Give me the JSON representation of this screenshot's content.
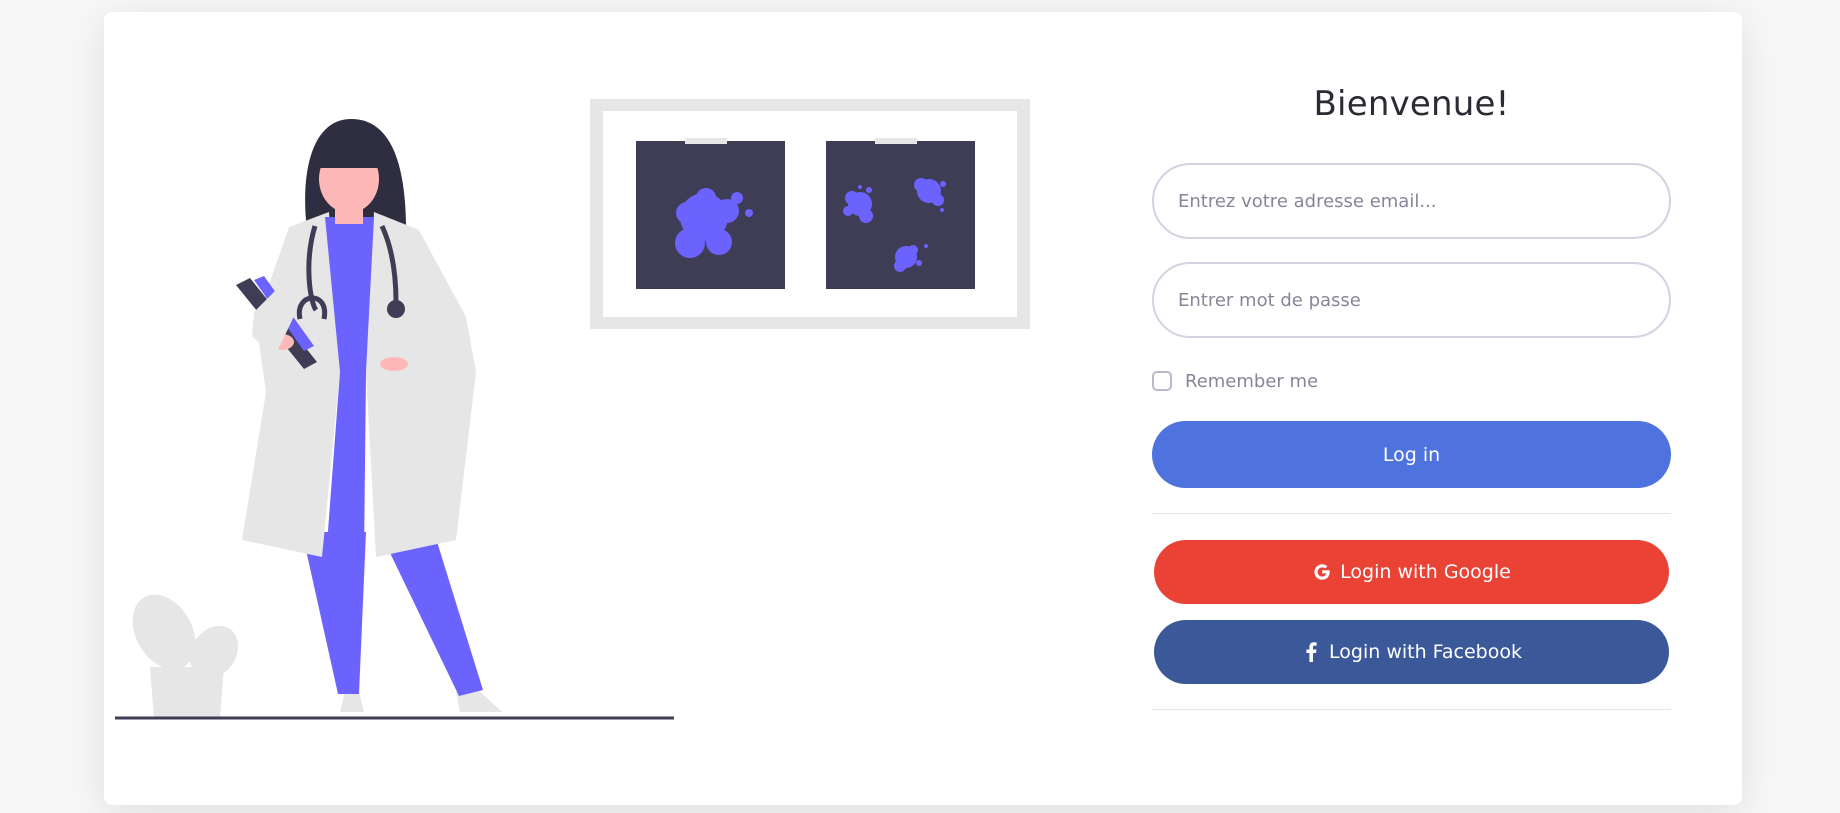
{
  "login": {
    "title": "Bienvenue!",
    "email_placeholder": "Entrez votre adresse email...",
    "password_placeholder": "Entrer mot de passe",
    "remember_label": "Remember me",
    "login_label": "Log in",
    "google_label": "Login with Google",
    "facebook_label": "Login with Facebook"
  },
  "colors": {
    "primary": "#4e73df",
    "google": "#ea4335",
    "facebook": "#3b5998",
    "accent_purple": "#6c63ff",
    "dark_panel": "#3f3d56"
  },
  "icons": {
    "google": "google-icon",
    "facebook": "facebook-icon"
  }
}
